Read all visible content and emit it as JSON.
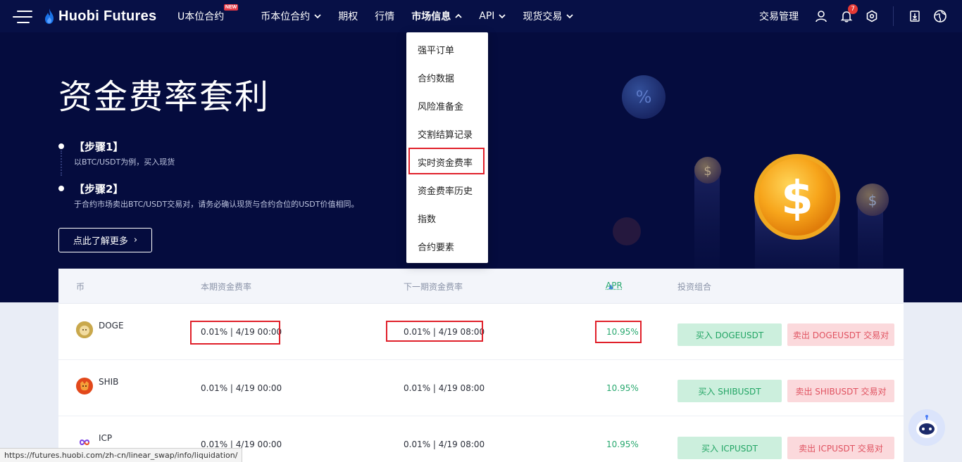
{
  "header": {
    "logo_text": "Huobi Futures",
    "nav": [
      {
        "label": "U本位合约",
        "badge": "NEW"
      },
      {
        "label": "币本位合约"
      },
      {
        "label": "期权"
      },
      {
        "label": "行情"
      },
      {
        "label": "市场信息"
      },
      {
        "label": "API"
      },
      {
        "label": "现货交易"
      }
    ],
    "trade_mgmt": "交易管理",
    "notification_count": "7"
  },
  "dropdown": {
    "items": [
      "强平订单",
      "合约数据",
      "风险准备金",
      "交割结算记录",
      "实时资金费率",
      "资金费率历史",
      "指数",
      "合约要素"
    ]
  },
  "hero": {
    "title": "资金费率套利",
    "step1_title": "【步骤1】",
    "step1_desc": "以BTC/USDT为例，买入现货",
    "step2_title": "【步骤2】",
    "step2_desc": "于合约市场卖出BTC/USDT交易对，请务必确认现货与合约合位的USDT价值相同。",
    "learn_more": "点此了解更多"
  },
  "table": {
    "headers": {
      "coin": "币",
      "current_rate": "本期资金费率",
      "next_rate": "下一期资金费率",
      "apr": "APR",
      "portfolio": "投资组合"
    },
    "rows": [
      {
        "coin": "DOGE",
        "current": "0.01% | 4/19 00:00",
        "next": "0.01% | 4/19 08:00",
        "apr": "10.95%",
        "buy": "买入 DOGEUSDT",
        "sell": "卖出 DOGEUSDT 交易对"
      },
      {
        "coin": "SHIB",
        "current": "0.01% | 4/19 00:00",
        "next": "0.01% | 4/19 08:00",
        "apr": "10.95%",
        "buy": "买入 SHIBUSDT",
        "sell": "卖出 SHIBUSDT 交易对"
      },
      {
        "coin": "ICP",
        "current": "0.01% | 4/19 00:00",
        "next": "0.01% | 4/19 08:00",
        "apr": "10.95%",
        "buy": "买入 ICPUSDT",
        "sell": "卖出 ICPUSDT 交易对"
      }
    ]
  },
  "status_url": "https://futures.huobi.com/zh-cn/linear_swap/info/liquidation/",
  "colors": {
    "navy": "#071046",
    "hero_bg": "#050c3e",
    "buy_text": "#23a565",
    "sell_text": "#e05260",
    "highlight": "#e0202a"
  }
}
